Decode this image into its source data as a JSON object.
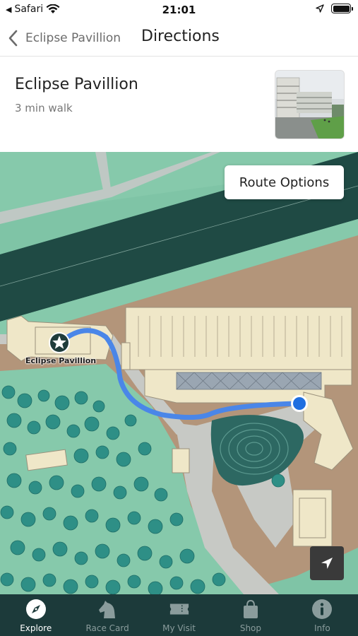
{
  "status_bar": {
    "carrier": "Safari",
    "time": "21:01",
    "battery_level": 1.0
  },
  "nav": {
    "back_label": "Eclipse Pavillion",
    "title": "Directions"
  },
  "destination": {
    "name": "Eclipse Pavillion",
    "walk_time": "3 min walk"
  },
  "map": {
    "route_options_label": "Route Options",
    "destination_label": "Eclipse Pavillion",
    "colors": {
      "grass": "#7fc4a6",
      "river": "#1f4a44",
      "ground": "#b3957a",
      "building": "#efe7c8",
      "path": "#c9c9c9",
      "route": "#4a86e8",
      "trees": "#2e8f86"
    }
  },
  "tabs": [
    {
      "label": "Explore",
      "icon": "compass-icon",
      "active": true
    },
    {
      "label": "Race Card",
      "icon": "horse-head-icon",
      "active": false
    },
    {
      "label": "My Visit",
      "icon": "ticket-icon",
      "active": false
    },
    {
      "label": "Shop",
      "icon": "shopping-bag-icon",
      "active": false
    },
    {
      "label": "Info",
      "icon": "info-icon",
      "active": false
    }
  ]
}
